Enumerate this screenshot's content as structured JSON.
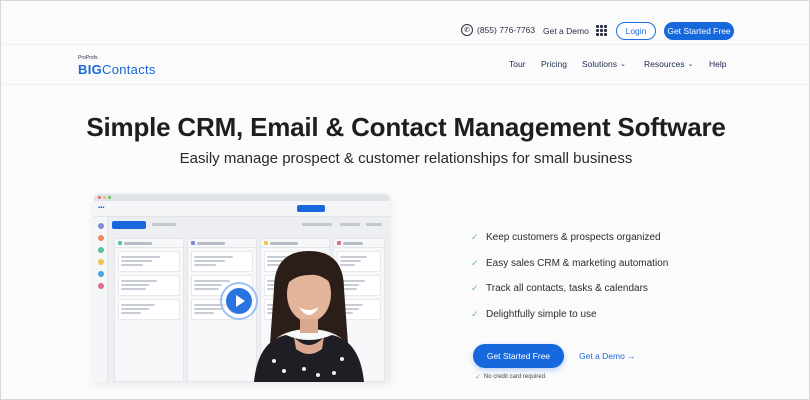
{
  "topbar": {
    "phone": "(855) 776-7763",
    "demo_label": "Get a Demo",
    "login_label": "Login",
    "start_label": "Get Started Free"
  },
  "logo": {
    "small": "ProProfs",
    "big": "BIG",
    "rest": "Contacts"
  },
  "nav": {
    "items": [
      {
        "label": "Tour"
      },
      {
        "label": "Pricing"
      },
      {
        "label": "Solutions",
        "has_dropdown": true
      },
      {
        "label": "Resources",
        "has_dropdown": true
      },
      {
        "label": "Help"
      }
    ]
  },
  "hero": {
    "title": "Simple CRM, Email & Contact Management Software",
    "subtitle": "Easily manage prospect & customer relationships for small business"
  },
  "features": [
    {
      "label": "Keep customers & prospects organized"
    },
    {
      "label": "Easy sales CRM & marketing automation"
    },
    {
      "label": "Track all contacts, tasks & calendars"
    },
    {
      "label": "Delightfully simple to use"
    }
  ],
  "cta": {
    "primary_label": "Get Started Free",
    "demo_label": "Get a Demo →",
    "note": "No credit card required."
  },
  "icons": {
    "phone": "phone-icon",
    "apps": "grid-icon",
    "play": "play-icon",
    "check": "check-icon",
    "chevron": "chevron-down-icon"
  },
  "colors": {
    "accent": "#1668dc",
    "check": "#6ab98a",
    "title": "#1e1e1e"
  }
}
